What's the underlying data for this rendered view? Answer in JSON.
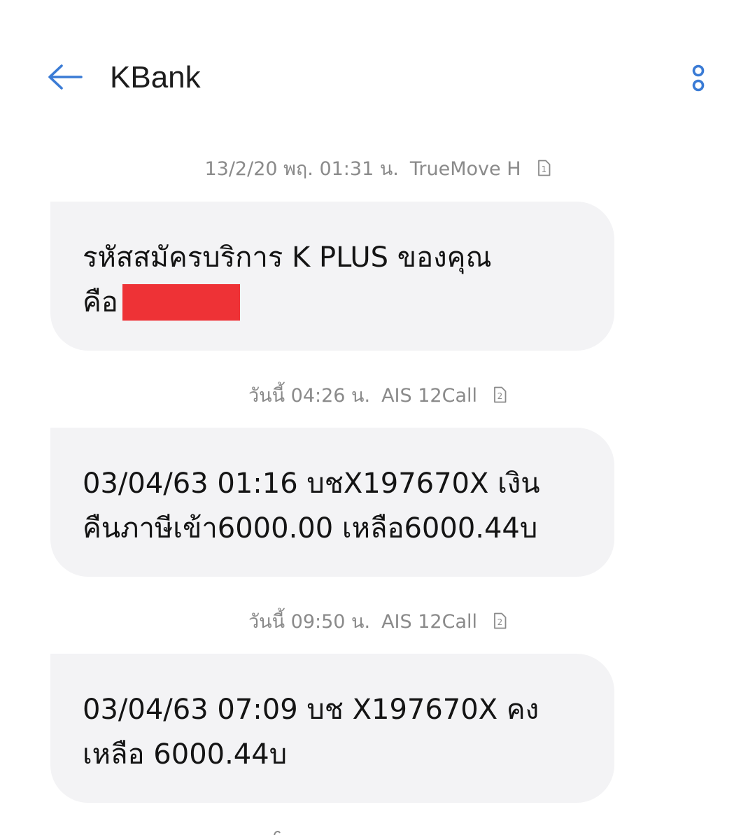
{
  "header": {
    "title": "KBank",
    "back_icon": "back-arrow-icon",
    "more_icon": "more-vertical-icon",
    "accent_color": "#3a7bd5"
  },
  "messages": [
    {
      "timestamp": "13/2/20 พฤ. 01:31 น.",
      "carrier": "TrueMove H",
      "sim": "1",
      "body_line1": "รหัสสมัครบริการ K PLUS ของคุณ",
      "body_line2": "คือ"
    },
    {
      "timestamp": "วันนี้ 04:26 น.",
      "carrier": "AIS 12Call",
      "sim": "2",
      "body_line1": "03/04/63 01:16 บชX197670X เงิน",
      "body_line2": "คืนภาษีเข้า6000.00 เหลือ6000.44บ"
    },
    {
      "timestamp": "วันนี้ 09:50 น.",
      "carrier": "AIS 12Call",
      "sim": "2",
      "body_line1": "03/04/63 07:09 บช X197670X คง",
      "body_line2": "เหลือ 6000.44บ"
    }
  ],
  "colors": {
    "bubble_bg": "#f3f3f5",
    "meta_text": "#8a8a8a",
    "redaction": "#ee3236"
  }
}
